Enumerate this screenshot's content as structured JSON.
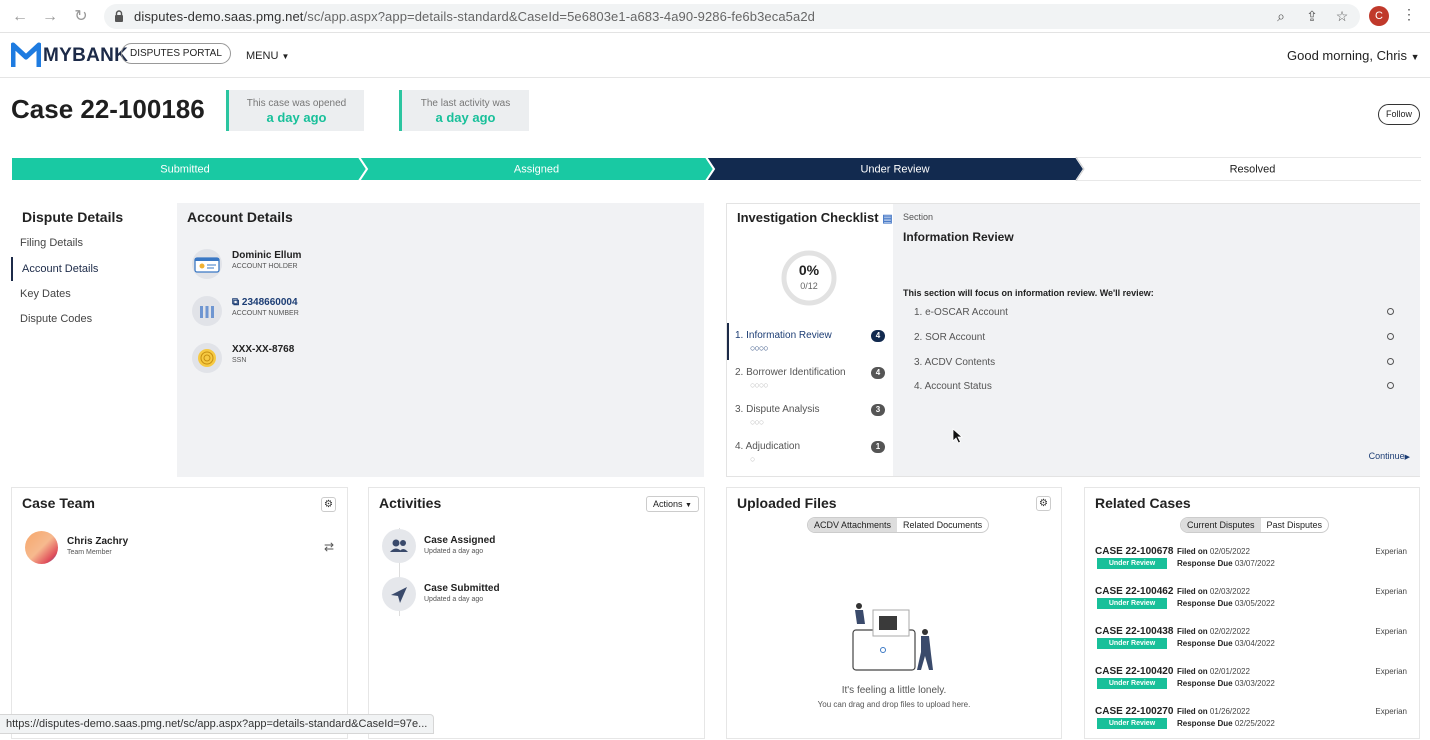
{
  "browser": {
    "url_host": "disputes-demo.saas.pmg.net",
    "url_path": "/sc/app.aspx?app=details-standard&CaseId=5e6803e1-a683-4a90-9286-fe6b3eca5a2d",
    "profile_initial": "C",
    "status_url": "https://disputes-demo.saas.pmg.net/sc/app.aspx?app=details-standard&CaseId=97e..."
  },
  "header": {
    "logo_text": "MYBANK",
    "portal_label": "DISPUTES PORTAL",
    "menu_label": "MENU",
    "greeting": "Good morning, Chris"
  },
  "case": {
    "title": "Case 22-100186",
    "opened_label": "This case was opened",
    "opened_value": "a day ago",
    "activity_label": "The last activity was",
    "activity_value": "a day ago",
    "follow_label": "Follow"
  },
  "progress": {
    "steps": [
      "Submitted",
      "Assigned",
      "Under Review",
      "Resolved"
    ],
    "current_index": 2,
    "colors": {
      "done": "#19c9a3",
      "current": "#122a4f",
      "todo": "#ffffff"
    }
  },
  "dispute_details": {
    "title": "Dispute Details",
    "items": [
      "Filing Details",
      "Account Details",
      "Key Dates",
      "Dispute Codes"
    ],
    "active_index": 1
  },
  "account_details": {
    "title": "Account Details",
    "holder_name": "Dominic Ellum",
    "holder_label": "ACCOUNT HOLDER",
    "account_number": "2348660004",
    "account_label": "ACCOUNT NUMBER",
    "ssn": "XXX-XX-8768",
    "ssn_label": "SSN"
  },
  "checklist": {
    "title": "Investigation Checklist",
    "percent": "0%",
    "fraction": "0/12",
    "sections": [
      {
        "label": "1.  Information Review",
        "count": "4",
        "dots": "○○○○"
      },
      {
        "label": "2.  Borrower Identification",
        "count": "4",
        "dots": "○○○○"
      },
      {
        "label": "3.  Dispute Analysis",
        "count": "3",
        "dots": "○○○"
      },
      {
        "label": "4.  Adjudication",
        "count": "1",
        "dots": "○"
      }
    ],
    "section_caption": "Section",
    "section_title": "Information Review",
    "intro": "This section will focus on information review. We'll review:",
    "review_items": [
      "1.   e-OSCAR Account",
      "2.   SOR Account",
      "3.   ACDV Contents",
      "4.   Account Status"
    ],
    "continue_label": "Continue"
  },
  "case_team": {
    "title": "Case Team",
    "member_name": "Chris Zachry",
    "member_role": "Team Member"
  },
  "activities": {
    "title": "Activities",
    "actions_label": "Actions",
    "items": [
      {
        "title": "Case Assigned",
        "sub": "Updated a day ago"
      },
      {
        "title": "Case Submitted",
        "sub": "Updated a day ago"
      }
    ]
  },
  "uploaded_files": {
    "title": "Uploaded Files",
    "tabs": [
      "ACDV Attachments",
      "Related Documents"
    ],
    "empty_title": "It's feeling a little lonely.",
    "empty_sub": "You can drag and drop files to upload here."
  },
  "related_cases": {
    "title": "Related Cases",
    "tabs": [
      "Current Disputes",
      "Past Disputes"
    ],
    "filed_label": "Filed on",
    "due_label": "Response Due",
    "rows": [
      {
        "case": "CASE 22-100678",
        "status": "Under Review",
        "filed": "02/05/2022",
        "due": "03/07/2022",
        "bureau": "Experian"
      },
      {
        "case": "CASE 22-100462",
        "status": "Under Review",
        "filed": "02/03/2022",
        "due": "03/05/2022",
        "bureau": "Experian"
      },
      {
        "case": "CASE 22-100438",
        "status": "Under Review",
        "filed": "02/02/2022",
        "due": "03/04/2022",
        "bureau": "Experian"
      },
      {
        "case": "CASE 22-100420",
        "status": "Under Review",
        "filed": "02/01/2022",
        "due": "03/03/2022",
        "bureau": "Experian"
      },
      {
        "case": "CASE 22-100270",
        "status": "Under Review",
        "filed": "01/26/2022",
        "due": "02/25/2022",
        "bureau": "Experian"
      }
    ]
  }
}
